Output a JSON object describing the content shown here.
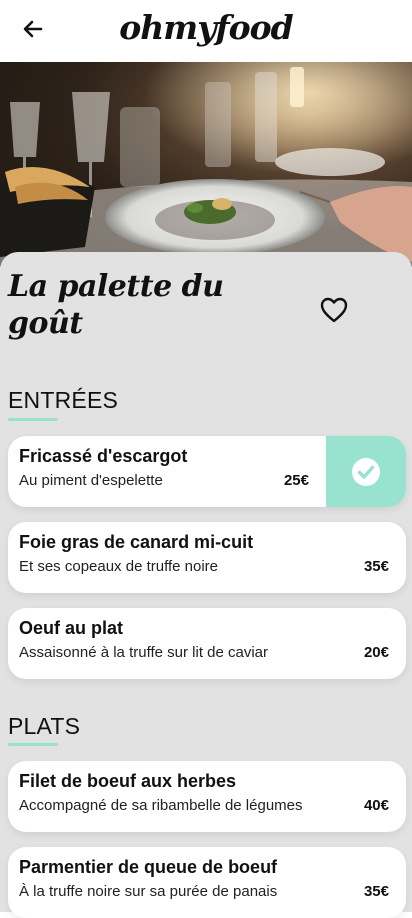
{
  "header": {
    "back_icon": "arrow-left-icon",
    "brand": "ohmyfood"
  },
  "hero": {
    "image": "restaurant-table-photo"
  },
  "restaurant": {
    "name": "La palette du goût",
    "favorite_icon": "heart-outline-icon"
  },
  "accent_color": "#99e2d0",
  "sections": [
    {
      "title": "ENTRÉES",
      "dishes": [
        {
          "name": "Fricassé d'escargot",
          "description": "Au piment d'espelette",
          "price": "25€",
          "selected": true
        },
        {
          "name": "Foie gras de canard mi-cuit",
          "description": "Et ses copeaux de truffe noire",
          "price": "35€",
          "selected": false
        },
        {
          "name": "Oeuf au plat",
          "description": "Assaisonné à la truffe sur lit de caviar",
          "price": "20€",
          "selected": false
        }
      ]
    },
    {
      "title": "PLATS",
      "dishes": [
        {
          "name": "Filet de boeuf aux herbes",
          "description": "Accompagné de sa ribambelle de légumes",
          "price": "40€",
          "selected": false
        },
        {
          "name": "Parmentier de queue de boeuf",
          "description": "À la truffe noire sur sa purée de panais",
          "price": "35€",
          "selected": false
        }
      ]
    }
  ]
}
